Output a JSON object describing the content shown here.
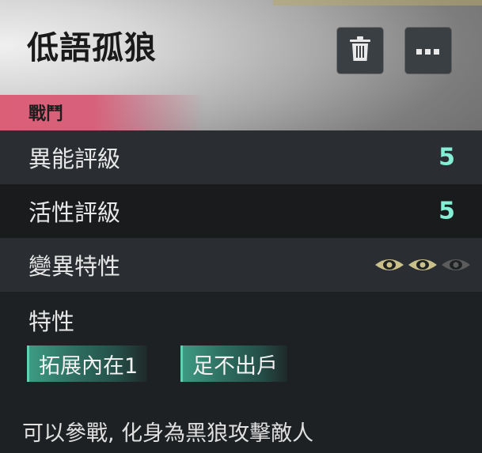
{
  "card": {
    "title": "低語孤狼",
    "category": "戰鬥",
    "actions": {
      "delete_icon": "trash-icon",
      "more_icon": "more-icon"
    }
  },
  "stats": [
    {
      "label": "異能評級",
      "value": "5"
    },
    {
      "label": "活性評級",
      "value": "5"
    }
  ],
  "mutation": {
    "label": "變異特性",
    "level_active": 2,
    "level_total": 3,
    "active_color": "#c9c08a",
    "inactive_color": "#5c5c5c"
  },
  "traits": {
    "title": "特性",
    "tags": [
      "拓展內在1",
      "足不出戶"
    ]
  },
  "description": "可以參戰, 化身為黑狼攻擊敵人",
  "colors": {
    "accent_value": "#84efd4",
    "category_pink": "#dc5f78",
    "tag_green": "#3e9a83"
  }
}
